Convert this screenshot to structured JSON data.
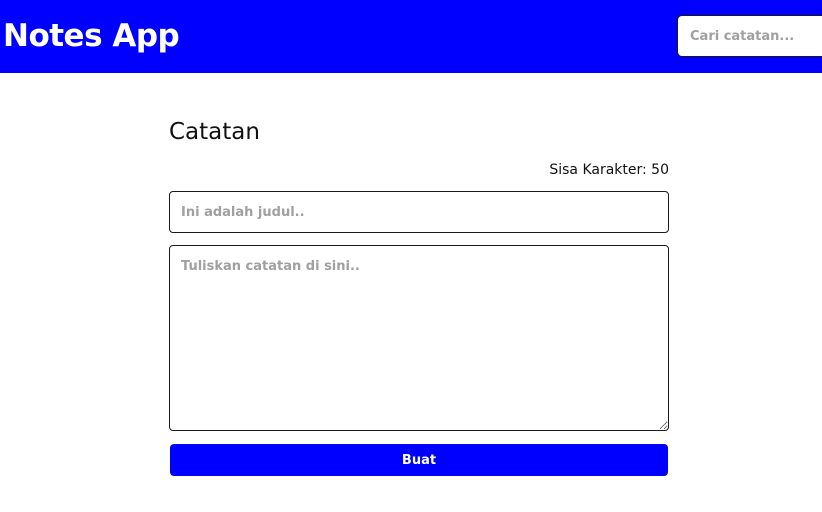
{
  "header": {
    "title": "Notes App",
    "search_placeholder": "Cari catatan..."
  },
  "form": {
    "heading": "Catatan",
    "char_counter": "Sisa Karakter: 50",
    "title_placeholder": "Ini adalah judul..",
    "body_placeholder": "Tuliskan catatan di sini..",
    "submit_label": "Buat"
  },
  "colors": {
    "primary": "#0000ff",
    "background": "#ffffff",
    "placeholder": "#a0a0a0"
  }
}
